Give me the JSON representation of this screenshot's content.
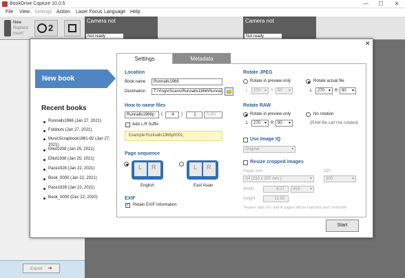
{
  "window": {
    "title": "BookDrive Capture 10.0.5",
    "min": "—",
    "max": "☐",
    "close": "✕"
  },
  "menu": [
    "File",
    "View",
    "Settings",
    "Action",
    "Laser Focus",
    "Language",
    "Help"
  ],
  "toolbar": {
    "new": "New",
    "replace": "Replace",
    "insert": "Insert",
    "cam_count": "2"
  },
  "cameras": {
    "left_title": "Camera not",
    "left_status": "Not ready",
    "right_title": "Camera not",
    "right_status": "Not ready"
  },
  "export": {
    "label": "Export"
  },
  "dialog": {
    "close": "✕",
    "new_book": "New book",
    "recent_title": "Recent books",
    "recent": [
      "Runnalls1966 (Jan 27, 2021)",
      "Foldouts (Jan 27, 2021)",
      "MusicScrapbook1981-82 (Jan 27, 2021)",
      "Elliot1938 (Jan 25, 2021)",
      "Elliot1938 (Jan 25, 2021)",
      "Pace1928 (Jan 22, 2021)",
      "Book_0000 (Jan 22, 2021)",
      "Pace1928 (Jan 22, 2021)",
      "Book_0000 (Dec 22, 2020)"
    ],
    "tabs": {
      "settings": "Settings",
      "metadata": "Metadata"
    },
    "location": {
      "heading": "Location",
      "book_name_label": "Book name",
      "book_name": "Runnalls1966",
      "destination_label": "Destination",
      "destination": "T:\\Ying\\#Scans\\Runnalls1966\\Runnall"
    },
    "naming": {
      "heading": "How to name files",
      "prefix": "Runnalls1966p",
      "paren_open": "(",
      "digits": "4",
      "paren_close": ")",
      "start": "1",
      "suffix_placeholder": "Suffix",
      "add_lr": "Add L,R Suffix",
      "example": "Example:Runnalls1966p0001,"
    },
    "sequence": {
      "heading": "Page sequence",
      "english": "English",
      "east_asian": "East Asian",
      "L": "L",
      "R": "R"
    },
    "exif": {
      "heading": "EXIF",
      "retain": "Retain EXIF information"
    },
    "rotate_jpeg": {
      "heading": "Rotate JPEG",
      "preview_only": "Rotate in preview only",
      "actual_file": "Rotate actual file",
      "L": "L",
      "R": "R",
      "l_val_dis": "270",
      "r_val_dis": "90",
      "l_val": "270",
      "r_val": "90"
    },
    "rotate_raw": {
      "heading": "Rotate RAW",
      "preview_only": "Rotate in preview only",
      "no_rotation": "No rotation",
      "note": "(RAW file can't be rotated)",
      "L": "L",
      "R": "R",
      "l_val": "270",
      "r_val": "90"
    },
    "image_iq": {
      "label": "Use Image IQ",
      "value": "Original"
    },
    "resize": {
      "label": "Resize cropped images",
      "paper_size_label": "Paper size",
      "paper_size": "A4 (210 x 297 mm )",
      "dpi_label": "DPI",
      "dpi": "300",
      "width_label": "Width",
      "width": "8.27",
      "unit": "inch",
      "height_label": "Height",
      "height": "11.69",
      "note": "*Aspect ratio of L and R pages will be matched and controlled."
    },
    "start": "Start"
  }
}
